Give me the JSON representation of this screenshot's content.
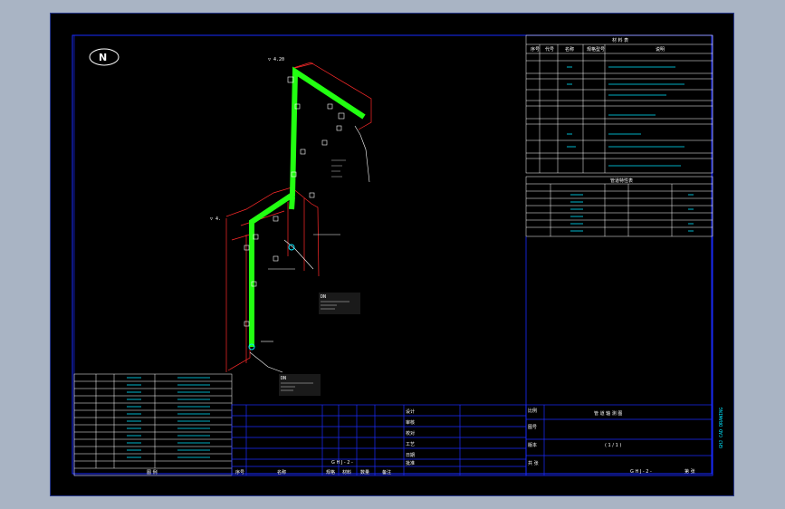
{
  "colors": {
    "background": "#a9b4c4",
    "sheet": "#000000",
    "frame": "#1a2bff",
    "pipe": "#22ff11",
    "wall": "#ff2a2a",
    "table_text_cyan": "#00e5ff",
    "text": "#ffffff"
  },
  "compass": {
    "label": "N"
  },
  "labels": {
    "top_elev": "▽ 4.20",
    "mid_elev": "▽ 4.",
    "note_a": "DN",
    "note_b": "DN"
  },
  "title_block": {
    "rows_left": [
      "设计",
      "审核",
      "校对",
      "工艺",
      "日期",
      "批准"
    ],
    "rows_right": [
      "比例",
      "图号",
      "版本",
      "共 张"
    ],
    "title": "管 道 轴 测 图",
    "drawing_no": "( 1 / 1 )",
    "bottom_id": "G H J - 2 -",
    "sheet_info": "第 张",
    "bottom_cells": [
      "序号",
      "名称",
      "规格",
      "材料",
      "数量",
      "备注"
    ]
  },
  "legend_table": {
    "title": "图 例",
    "rows": 12
  },
  "top_table": {
    "title": "材 料 表",
    "header": [
      "序号",
      "代号",
      "名称",
      "规格型号",
      "说明"
    ]
  },
  "mid_table": {
    "title": "管道特性表"
  },
  "side_text": "GHJ CAD DRAWING"
}
